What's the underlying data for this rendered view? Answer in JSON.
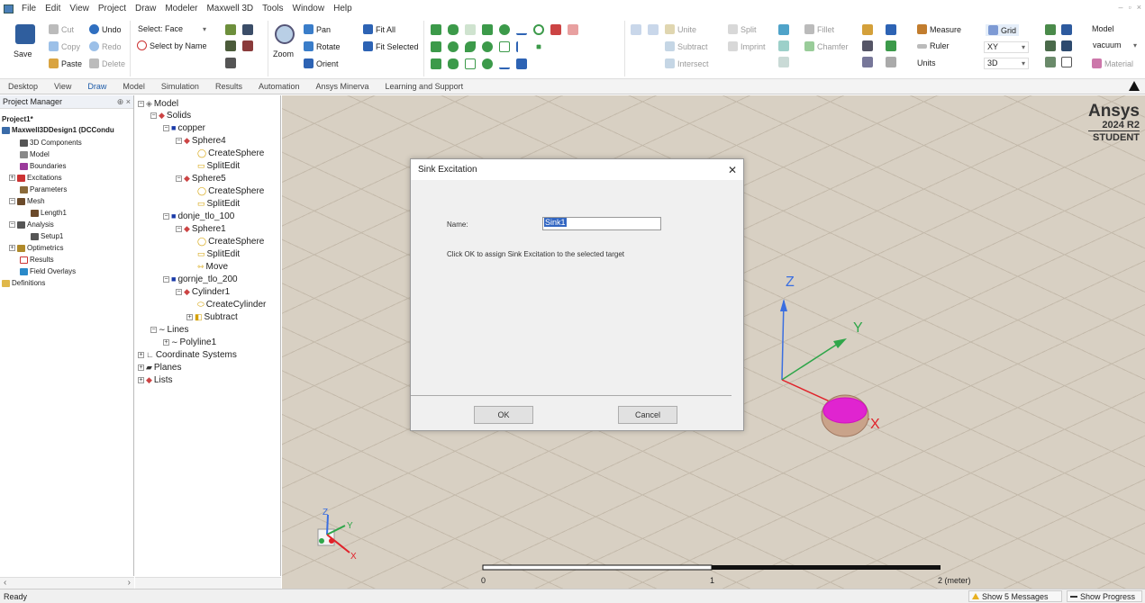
{
  "menubar": {
    "items": [
      "File",
      "Edit",
      "View",
      "Project",
      "Draw",
      "Modeler",
      "Maxwell 3D",
      "Tools",
      "Window",
      "Help"
    ]
  },
  "ribbon": {
    "save": "Save",
    "cut": "Cut",
    "copy": "Copy",
    "paste": "Paste",
    "undo": "Undo",
    "redo": "Redo",
    "delete": "Delete",
    "select_face": "Select: Face",
    "select_by_name": "Select by Name",
    "zoom": "Zoom",
    "pan": "Pan",
    "rotate": "Rotate",
    "orient": "Orient",
    "fit_all": "Fit All",
    "fit_selected": "Fit Selected",
    "unite": "Unite",
    "subtract": "Subtract",
    "intersect": "Intersect",
    "split": "Split",
    "imprint": "Imprint",
    "fillet": "Fillet",
    "chamfer": "Chamfer",
    "measure": "Measure",
    "ruler": "Ruler",
    "units": "Units",
    "grid": "Grid",
    "plane": "XY",
    "dim": "3D",
    "model": "Model",
    "material_value": "vacuum",
    "material": "Material"
  },
  "tabs": [
    "Desktop",
    "View",
    "Draw",
    "Model",
    "Simulation",
    "Results",
    "Automation",
    "Ansys Minerva",
    "Learning and Support"
  ],
  "project_manager": {
    "title": "Project Manager",
    "pin": "⊕ ×",
    "project": "Project1*",
    "design": "Maxwell3DDesign1 (DCCondu",
    "items": [
      "3D Components",
      "Model",
      "Boundaries",
      "Excitations",
      "Parameters",
      "Mesh",
      "Length1",
      "Analysis",
      "Setup1",
      "Optimetrics",
      "Results",
      "Field Overlays",
      "Definitions"
    ]
  },
  "tree": {
    "items": [
      "Model",
      "Solids",
      "copper",
      "Sphere4",
      "CreateSphere",
      "SplitEdit",
      "Sphere5",
      "CreateSphere",
      "SplitEdit",
      "donje_tlo_100",
      "Sphere1",
      "CreateSphere",
      "SplitEdit",
      "Move",
      "gornje_tlo_200",
      "Cylinder1",
      "CreateCylinder",
      "Subtract",
      "Lines",
      "Polyline1",
      "Coordinate Systems",
      "Planes",
      "Lists"
    ]
  },
  "viewport": {
    "brand": "Ansys",
    "version": "2024 R2",
    "edition": "STUDENT",
    "axis_z": "Z",
    "axis_y": "Y",
    "axis_x": "X",
    "triad_z": "Z",
    "triad_y": "Y",
    "triad_x": "X",
    "scale_start": "0",
    "scale_mid": "1",
    "scale_end": "2 (meter)"
  },
  "dialog": {
    "title": "Sink Excitation",
    "name_label": "Name:",
    "name_value": "Sink1",
    "message": "Click OK to assign Sink Excitation to the selected target",
    "ok": "OK",
    "cancel": "Cancel"
  },
  "status": {
    "ready": "Ready",
    "messages": "Show 5 Messages",
    "progress": "Show Progress"
  }
}
